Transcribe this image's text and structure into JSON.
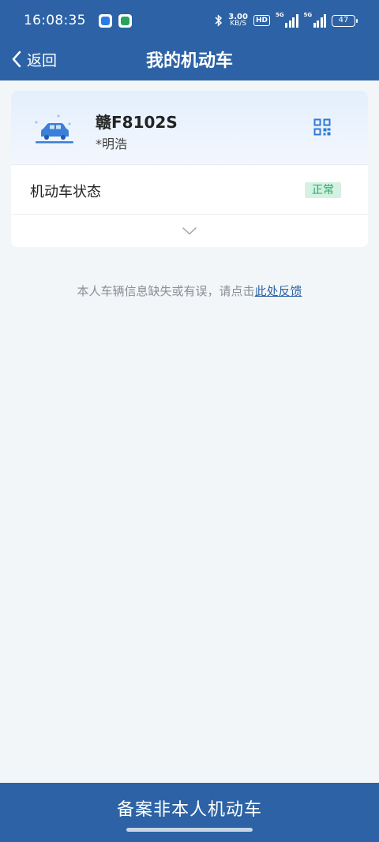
{
  "status_bar": {
    "time": "16:08:35",
    "net_speed_value": "3.00",
    "net_speed_unit": "KB/S",
    "hd_label": "HD",
    "sim1_label": "5G",
    "sim2_label": "5G",
    "battery": "47"
  },
  "nav": {
    "back_label": "返回",
    "title": "我的机动车"
  },
  "vehicle": {
    "plate": "赣F8102S",
    "owner": "*明浩",
    "status_label": "机动车状态",
    "status_value": "正常"
  },
  "feedback": {
    "text": "本人车辆信息缺失或有误，请点击",
    "link": "此处反馈"
  },
  "bottom_button": {
    "label": "备案非本人机动车"
  },
  "colors": {
    "primary": "#2d63a6",
    "background": "#f3f6f8",
    "status_ok_bg": "#d4f1e2",
    "status_ok_text": "#23a866"
  }
}
